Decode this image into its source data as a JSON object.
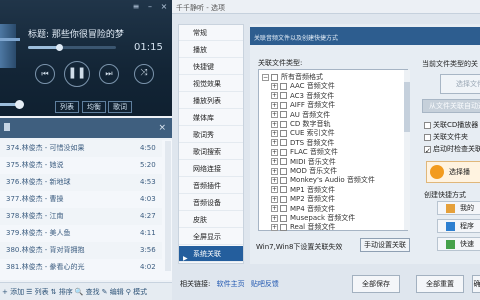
{
  "player": {
    "song_title": "标题: 那些你很冒险的梦",
    "time": "01:15",
    "progress": 0.35,
    "volume": 0.2,
    "tabs": [
      "列表",
      "均衡",
      "歌词"
    ],
    "playlist": [
      {
        "name": "374.林俊杰 - 可惜没如果",
        "duration": "4:50"
      },
      {
        "name": "375.林俊杰 - 她说",
        "duration": "5:20"
      },
      {
        "name": "376.林俊杰 - 新地球",
        "duration": "4:53"
      },
      {
        "name": "377.林俊杰 - 曹操",
        "duration": "4:03"
      },
      {
        "name": "378.林俊杰 - 江南",
        "duration": "4:27"
      },
      {
        "name": "379.林俊杰 - 美人鱼",
        "duration": "4:11"
      },
      {
        "name": "380.林俊杰 - 背对背拥抱",
        "duration": "3:56"
      },
      {
        "name": "381.林俊杰 - 豢看心的光",
        "duration": "4:02"
      }
    ],
    "bottom_buttons": [
      "+ 添加",
      "☰ 列表",
      "⇅ 排序",
      "🔍 查找",
      "✎ 编辑",
      "⚲ 模式"
    ]
  },
  "dialog": {
    "title": "千千静听 - 选项",
    "nav_items": [
      "常规",
      "播放",
      "快捷键",
      "视觉效果",
      "播放列表",
      "媒体库",
      "歌词秀",
      "歌词搜索",
      "网络连接",
      "音频插件",
      "音频设备",
      "皮肤",
      "全屏显示",
      "系统关联"
    ],
    "active_nav": "系统关联",
    "banner": "关联音频文件以及创建快捷方式",
    "assoc_label": "关联文件类型:",
    "tree_items": [
      "所有音频格式",
      "AAC 音频文件",
      "AC3 音频文件",
      "AIFF 音频文件",
      "AU 音频文件",
      "CD 数字音轨",
      "CUE 索引文件",
      "DTS 音频文件",
      "FLAC 音频文件",
      "MIDI 音乐文件",
      "MOD 音乐文件",
      "Monkey's Audio 音频文件",
      "MP1 音频文件",
      "MP2 音频文件",
      "MP4 音频文件",
      "Musepack 音频文件",
      "Real 音频文件"
    ],
    "win78_text": "Win7,Win8下设置关联失效",
    "manual_btn": "手动设置关联",
    "cur_type_label": "当前文件类型的关",
    "select_btn": "选择文件",
    "auto_btn": "从文件关联自动选",
    "checks": [
      "关联CD播放器",
      "关联文件夹",
      "启动时检查关联"
    ],
    "select_player": "选择播",
    "shortcut_label": "创建快捷方式",
    "shortcut_buttons": [
      "我的",
      "程序",
      "快速"
    ],
    "links_label": "相关链接:",
    "links": [
      "软件主页",
      "贴吧反馈"
    ],
    "bottom_buttons": [
      "全部保存",
      "全部重置",
      "确"
    ]
  }
}
